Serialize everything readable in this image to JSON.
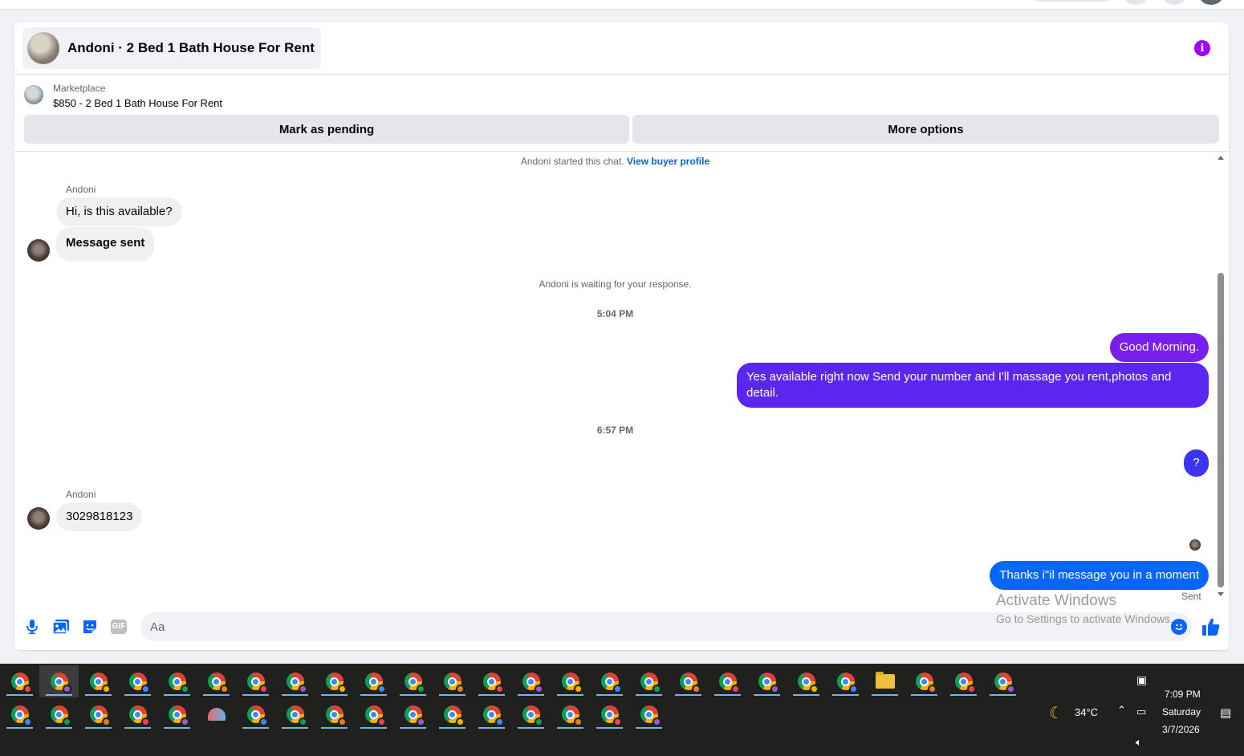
{
  "colors": {
    "accent": "#0866ff",
    "link": "#0a64d6",
    "info_purple": "#a100ff",
    "bubble_incoming": "#f0f0f0",
    "bubble_out_purple": "#7a1ef0",
    "bubble_out_indigo": "#4b2df0",
    "bubble_out_blue": "#0866ff"
  },
  "header": {
    "title": "Andoni · 2 Bed 1 Bath House For Rent",
    "info_icon": "info-icon"
  },
  "listing": {
    "kicker": "Marketplace",
    "title": "$850 - 2 Bed 1 Bath House For Rent",
    "buttons": {
      "pending": "Mark as pending",
      "more": "More options"
    }
  },
  "thread": {
    "started_text": "Andoni started this chat.",
    "view_profile": "View buyer profile",
    "sender_1": "Andoni",
    "msg_in_1": "Hi, is this available?",
    "msg_in_2": "Message sent",
    "waiting": "Andoni is waiting for your response.",
    "time_1": "5:04 PM",
    "msg_out_1": "Good Morning.",
    "msg_out_2_line1": "Yes available right now Send your number and I'll massage you rent,photos and",
    "msg_out_2_line2": "detail.",
    "time_2": "6:57 PM",
    "msg_out_3": "?",
    "sender_2": "Andoni",
    "msg_in_3": "3029818123",
    "msg_out_4": "Thanks i\"il message you in a moment",
    "status": "Sent"
  },
  "composer": {
    "placeholder": "Aa",
    "tools": [
      "microphone-icon",
      "photo-icon",
      "sticker-icon",
      "gif-icon"
    ],
    "gif_label": "GIF",
    "emoji_icon": "emoji-icon",
    "like_icon": "thumbs-up-icon"
  },
  "watermark": {
    "line1": "Activate Windows",
    "line2": "Go to Settings to activate Windows."
  },
  "taskbar": {
    "weather_temp": "34°C",
    "weather_icon": "moon-icon",
    "time": "7:09 PM",
    "day": "Saturday",
    "date": "3/7/2026"
  }
}
